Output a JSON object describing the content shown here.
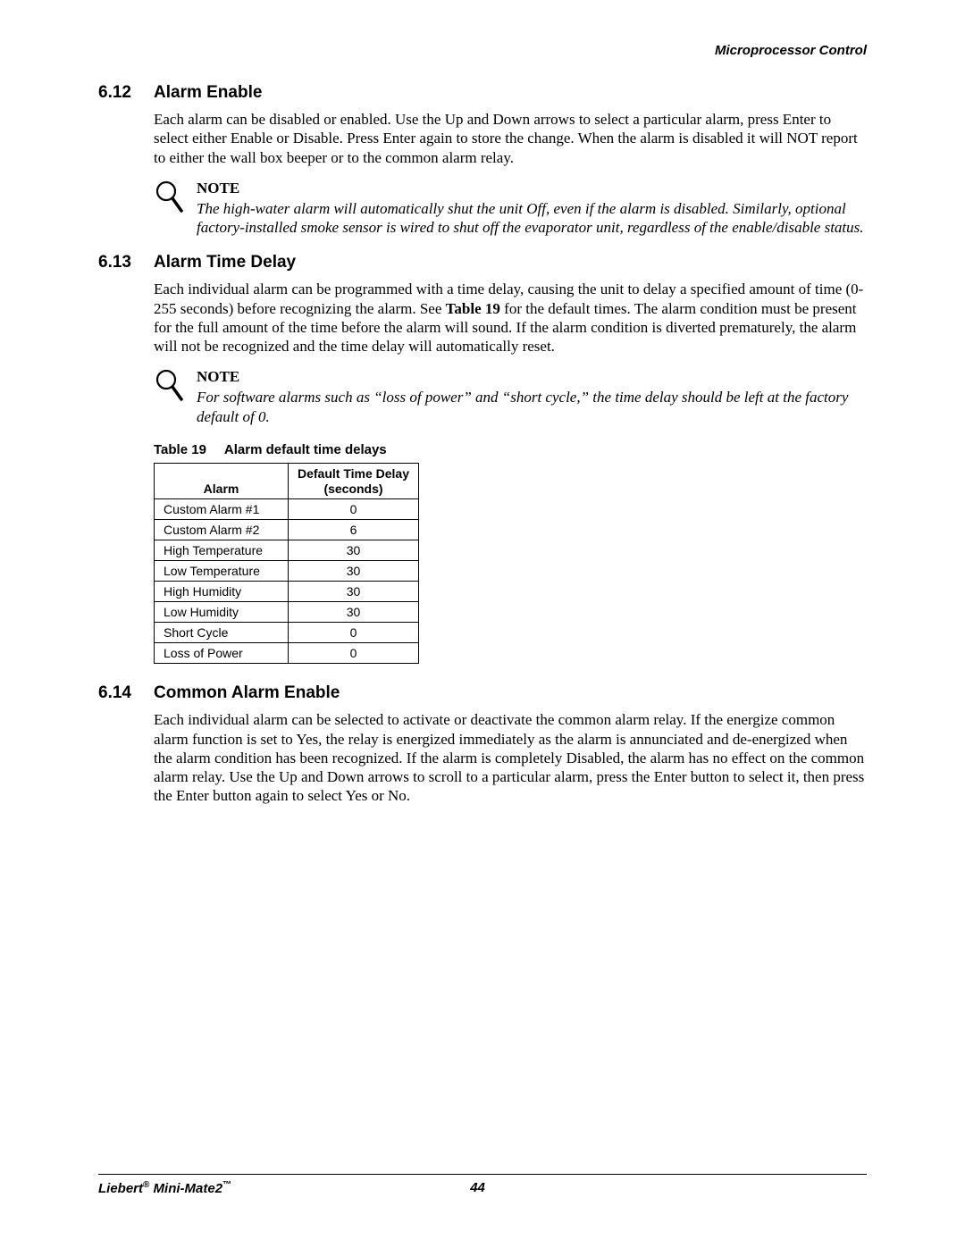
{
  "header": {
    "chapter": "Microprocessor Control"
  },
  "sections": [
    {
      "num": "6.12",
      "title": "Alarm Enable",
      "body": "Each alarm can be disabled or enabled. Use the Up and Down arrows to select a particular alarm, press Enter to select either Enable or Disable. Press Enter again to store the change. When the alarm is disabled it will NOT report to either the wall box beeper or to the common alarm relay.",
      "note": {
        "heading": "NOTE",
        "body": "The high-water alarm will automatically shut the unit Off, even if the alarm is disabled. Similarly, optional factory-installed smoke sensor is wired to shut off the evaporator unit, regardless of the enable/disable status."
      }
    },
    {
      "num": "6.13",
      "title": "Alarm Time Delay",
      "body_pre": "Each individual alarm can be programmed with a time delay, causing the unit to delay a specified amount of time (0-255 seconds) before recognizing the alarm. See ",
      "body_ref": "Table 19",
      "body_post": " for the default times. The alarm condition must be present for the full amount of the time before the alarm will sound. If the alarm condition is diverted prematurely, the alarm will not be recognized and the time delay will automatically reset.",
      "note": {
        "heading": "NOTE",
        "body": "For software alarms such as “loss of power” and “short cycle,” the time delay should be left at the factory default of 0."
      },
      "table": {
        "caption_label": "Table 19",
        "caption_title": "Alarm default time delays",
        "col1": "Alarm",
        "col2a": "Default Time Delay",
        "col2b": "(seconds)",
        "rows": [
          {
            "alarm": "Custom Alarm #1",
            "delay": "0"
          },
          {
            "alarm": "Custom Alarm #2",
            "delay": "6"
          },
          {
            "alarm": "High Temperature",
            "delay": "30"
          },
          {
            "alarm": "Low Temperature",
            "delay": "30"
          },
          {
            "alarm": "High Humidity",
            "delay": "30"
          },
          {
            "alarm": "Low Humidity",
            "delay": "30"
          },
          {
            "alarm": "Short Cycle",
            "delay": "0"
          },
          {
            "alarm": "Loss of Power",
            "delay": "0"
          }
        ]
      }
    },
    {
      "num": "6.14",
      "title": "Common Alarm Enable",
      "body": "Each individual alarm can be selected to activate or deactivate the common alarm relay. If the energize common alarm function is set to Yes, the relay is energized immediately as the alarm is annunciated and de-energized when the alarm condition has been recognized. If the alarm is completely Disabled, the alarm has no effect on the common alarm relay. Use the Up and Down arrows to scroll to a particular alarm, press the Enter button to select it, then press the Enter button again to select Yes or No."
    }
  ],
  "footer": {
    "product_a": "Liebert",
    "product_b": " Mini-Mate2",
    "page": "44"
  }
}
